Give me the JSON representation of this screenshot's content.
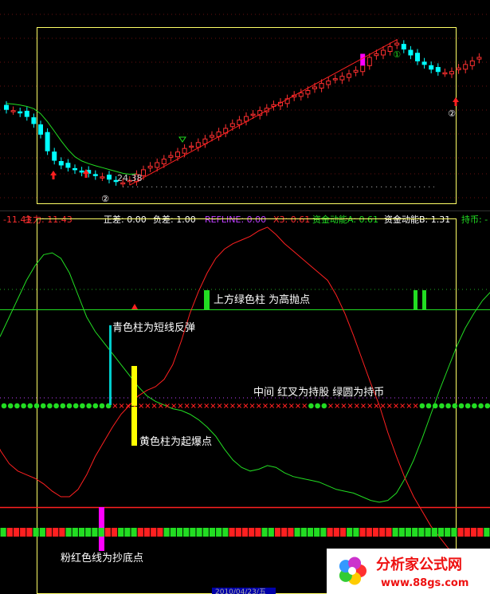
{
  "colors": {
    "background": "#000000",
    "up": "#ff3030",
    "down": "#00ffff",
    "frame": "#ffff66",
    "green": "#22dd22",
    "red": "#ff2020",
    "yellow": "#ffff00",
    "magenta": "#ff00ff",
    "cyan": "#00cccc",
    "refline": "#c040ff"
  },
  "status_bar": {
    "items": [
      {
        "text": "-11.43",
        "color": "#ff3030"
      },
      {
        "text": "主力: 11.43",
        "color": "#ff3030"
      },
      {
        "text": "正差: 0.00",
        "color": "#ffffff"
      },
      {
        "text": "负差: 1.00",
        "color": "#ffffff"
      },
      {
        "text": "REFLINE: 0.00",
        "color": "#c040ff"
      },
      {
        "text": "X3: 0.61",
        "color": "#ff3030"
      },
      {
        "text": "资金动能A: 0.61",
        "color": "#22dd22"
      },
      {
        "text": "资金动能B: 1.31",
        "color": "#ffffff"
      },
      {
        "text": "持币: -",
        "color": "#22dd22"
      }
    ]
  },
  "price_panel": {
    "low_price_label": "24.38",
    "circled_markers": [
      "①",
      "②",
      "②"
    ]
  },
  "annotations": {
    "green_bar": "上方绿色柱 为高抛点",
    "cyan_bar": "青色柱为短线反弹",
    "middle": "中间 红叉为持股  绿圆为持币",
    "yellow_bar": "黄色柱为起爆点",
    "pink_line": "粉红色线为抄底点"
  },
  "watermark": {
    "brand": "分析家公式网",
    "url": "www.88gs.com"
  },
  "bottom_axis_date": "2010/04/23/五",
  "chart_data": [
    {
      "type": "candlestick",
      "title": "",
      "ylabel": "",
      "annotations": [
        "24.38"
      ],
      "closes": [
        30.6,
        30.5,
        30.3,
        30.0,
        29.4,
        28.5,
        27.1,
        26.3,
        25.9,
        25.7,
        25.5,
        25.3,
        25.2,
        25.0,
        24.9,
        24.7,
        24.5,
        24.4,
        24.6,
        25.1,
        25.5,
        25.8,
        26.1,
        26.4,
        26.7,
        27.0,
        27.3,
        27.5,
        27.8,
        28.1,
        28.4,
        28.7,
        29.0,
        29.4,
        29.7,
        30.0,
        30.2,
        30.5,
        30.7,
        31.0,
        31.2,
        31.5,
        31.8,
        32.0,
        32.2,
        32.5,
        32.8,
        33.0,
        33.2,
        33.4,
        33.6,
        33.9,
        34.4,
        35.0,
        35.3,
        35.6,
        35.9,
        36.2,
        35.7,
        35.2,
        34.7,
        34.4,
        34.0,
        33.8,
        33.7,
        33.8,
        34.1,
        34.4,
        34.7,
        35.0
      ],
      "trend_line_start_index": 18,
      "trend_line_end_index": 57
    },
    {
      "type": "line",
      "title": "",
      "series": [
        {
          "color": "#22dd22",
          "values": [
            0.3,
            0.38,
            0.48,
            0.58,
            0.68,
            0.76,
            0.82,
            0.83,
            0.8,
            0.72,
            0.6,
            0.48,
            0.4,
            0.34,
            0.28,
            0.22,
            0.16,
            0.1,
            0.05,
            0.02,
            0.0,
            -0.02,
            -0.03,
            -0.05,
            -0.08,
            -0.12,
            -0.17,
            -0.24,
            -0.3,
            -0.34,
            -0.36,
            -0.35,
            -0.33,
            -0.34,
            -0.37,
            -0.39,
            -0.4,
            -0.41,
            -0.42,
            -0.44,
            -0.46,
            -0.47,
            -0.48,
            -0.5,
            -0.52,
            -0.53,
            -0.52,
            -0.48,
            -0.4,
            -0.3,
            -0.18,
            -0.05,
            0.08,
            0.2,
            0.32,
            0.42,
            0.5,
            0.57,
            0.62,
            0.66
          ]
        },
        {
          "color": "#ff2020",
          "values": [
            -0.15,
            -0.25,
            -0.32,
            -0.36,
            -0.38,
            -0.4,
            -0.43,
            -0.47,
            -0.5,
            -0.5,
            -0.46,
            -0.38,
            -0.28,
            -0.2,
            -0.12,
            -0.05,
            0.0,
            0.05,
            0.08,
            0.1,
            0.14,
            0.22,
            0.35,
            0.5,
            0.62,
            0.72,
            0.8,
            0.85,
            0.88,
            0.9,
            0.92,
            0.95,
            0.97,
            0.93,
            0.88,
            0.84,
            0.8,
            0.76,
            0.72,
            0.68,
            0.6,
            0.5,
            0.38,
            0.25,
            0.12,
            0.0,
            -0.15,
            -0.28,
            -0.4,
            -0.5,
            -0.58,
            -0.66,
            -0.72,
            -0.78,
            -0.82,
            -0.86,
            -0.9,
            -0.92,
            -0.94,
            -0.95
          ]
        }
      ]
    }
  ]
}
